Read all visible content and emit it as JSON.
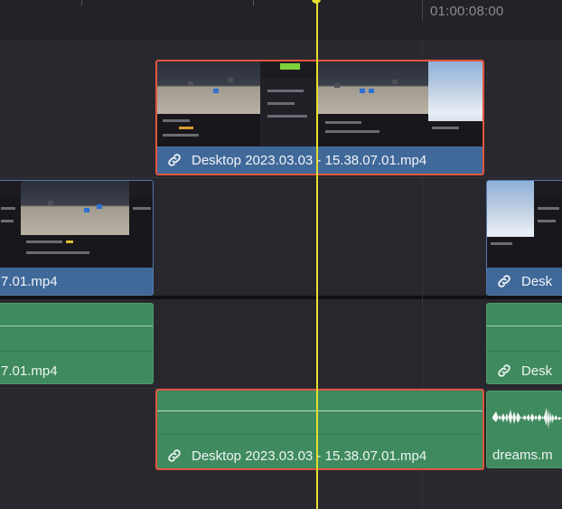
{
  "ruler": {
    "timecode": "01:00:08:00"
  },
  "tracks": {
    "v2": {
      "clips": [
        {
          "name": "Desktop 2023.03.03 - 15.38.07.01.mp4",
          "selected": true,
          "linked": true
        }
      ]
    },
    "v1": {
      "clips": [
        {
          "name": "7.01.mp4",
          "linked": false
        },
        {
          "name": "Desk",
          "linked": true
        }
      ]
    },
    "a1": {
      "clips": [
        {
          "name": "7.01.mp4",
          "linked": false
        },
        {
          "name": "Desk",
          "linked": true
        }
      ]
    },
    "a2": {
      "clips": [
        {
          "name": "Desktop 2023.03.03 - 15.38.07.01.mp4",
          "selected": true,
          "linked": true
        },
        {
          "name": "dreams.m",
          "linked": false
        }
      ]
    }
  },
  "colors": {
    "video_clip": "#40699a",
    "audio_clip": "#3f8a5f",
    "selection_border": "#e2553e",
    "playhead": "#e8df2a",
    "background": "#27262c"
  },
  "icons": {
    "link": "link-icon",
    "playhead": "playhead-marker"
  }
}
